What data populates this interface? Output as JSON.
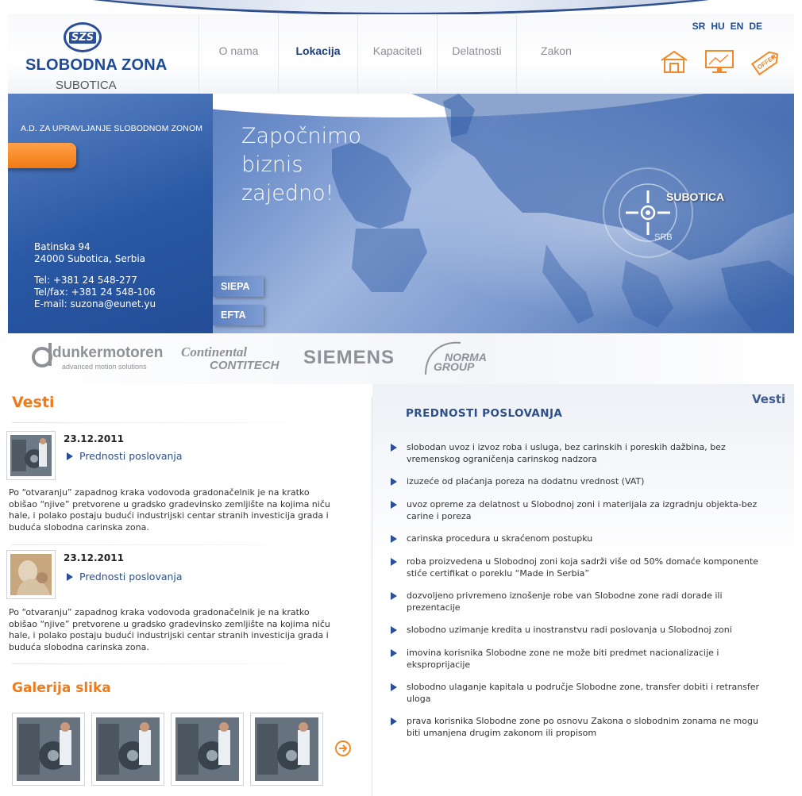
{
  "brand": {
    "badge": "SZS",
    "title": "SLOBODNA ZONA",
    "subtitle": "SUBOTICA"
  },
  "nav": {
    "items": [
      {
        "label": "O nama"
      },
      {
        "label": "Lokacija"
      },
      {
        "label": "Kapaciteti"
      },
      {
        "label": "Delatnosti"
      },
      {
        "label": "Zakon"
      }
    ],
    "active_index": 1
  },
  "languages": [
    "SR",
    "HU",
    "EN",
    "DE"
  ],
  "header_icons": [
    "home-icon",
    "monitor-icon",
    "offer-tag-icon"
  ],
  "header_icon_tag_text": "OFFER",
  "hero": {
    "company_line": "A.D. ZA UPRAVLJANJE SLOBODNOM ZONOM",
    "slogan": [
      "Započnimo",
      "biznis",
      "zajedno!"
    ],
    "address_line1": "Batinska 94",
    "address_line2": "24000 Subotica, Serbia",
    "phone": "Tel: +381 24 548-277",
    "fax": "Tel/fax: +381 24 548-106",
    "email": "E-mail: suzona@eunet.yu",
    "buttons": [
      "SIEPA",
      "EFTA"
    ],
    "target_label": "SUBOTICA",
    "target_sub": "SRB"
  },
  "partners": {
    "dunker": "dunkermotoren",
    "dunker_sub": "advanced motion solutions",
    "continental": "Continental",
    "contitech": "CONTITECH",
    "siemens": "SIEMENS",
    "norma1": "NORMA",
    "norma2": "GROUP"
  },
  "news": {
    "title": "Vesti",
    "items": [
      {
        "date": "23.12.2011",
        "link": "Prednosti poslovanja",
        "text": "Po “otvaranju” zapadnog kraka vodovoda gradonačelnik je na kratko obišao “njive” pretvorene u gradsko gradevinsko zemljište na kojima niču hale, i polako postaju budući industrijski centar stranih investicija grada i buduća slobodna carinska zona."
      },
      {
        "date": "23.12.2011",
        "link": "Prednosti poslovanja",
        "text": "Po “otvaranju” zapadnog kraka vodovoda gradonačelnik je na kratko obišao “njive” pretvorene u gradsko gradevinsko zemljište na kojima niču hale, i polako postaju budući industrijski centar stranih investicija grada i buduća slobodna carinska zona."
      }
    ]
  },
  "gallery": {
    "title": "Galerija slika"
  },
  "advantages": {
    "vesti_link": "Vesti",
    "title": "PREDNOSTI POSLOVANJA",
    "items": [
      "slobodan uvoz i izvoz roba i usluga, bez carinskih i poreskih dažbina, bez vremenskog ograničenja carinskog nadzora",
      "izuzeće od plaćanja poreza na dodatnu vrednost (VAT)",
      "uvoz opreme za delatnost u Slobodnoj zoni i materijala za izgradnju objekta-bez carine i poreza",
      "carinska procedura u skraćenom postupku",
      "roba proizvedena u Slobodnoj zoni koja sadrži više od 50% domaće komponente stiće certifikat o poreklu “Made in Serbia”",
      "dozvoljeno privremeno iznošenje robe van Slobodne zone radi dorade ili prezentacije",
      "slobodno uzimanje kredita u inostranstvu radi poslovanja u Slobodnoj zoni",
      "imovina korisnika Slobodne zone ne može biti predmet nacionalizacije i eksproprijacije",
      "slobodno ulaganje kapitala u područje Slobodne zone, transfer dobiti i retransfer uloga",
      "prava korisnika Slobodne zone po osnovu Zakona o slobodnim zonama ne mogu biti umanjena drugim zakonom ili propisom"
    ]
  },
  "colors": {
    "brand_blue": "#1d4a97",
    "accent_orange": "#f07b1c",
    "nav_inactive": "#8b8f98",
    "link_blue": "#2d4f8b"
  }
}
